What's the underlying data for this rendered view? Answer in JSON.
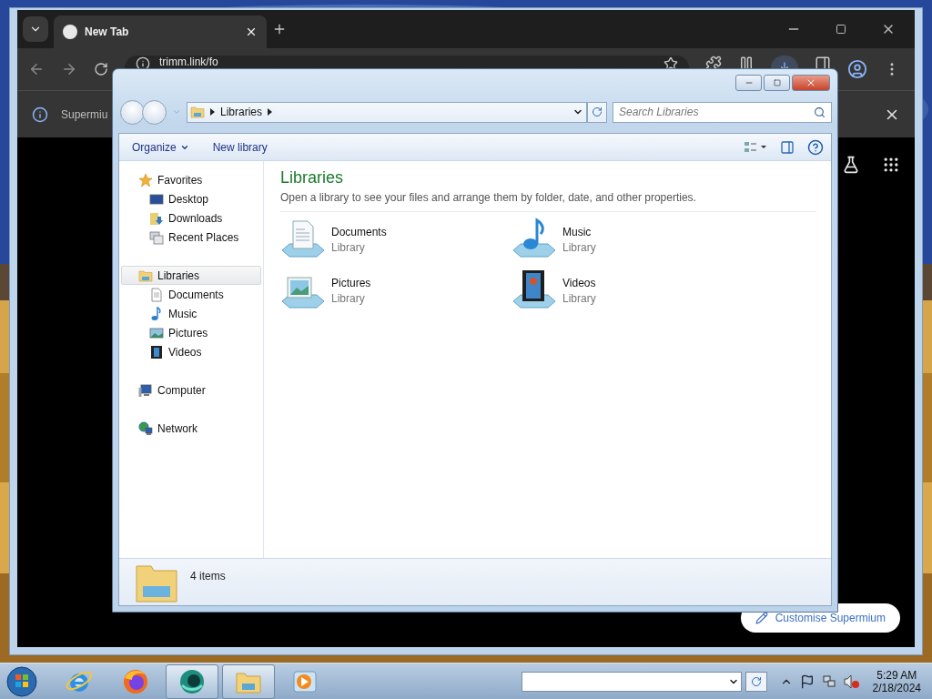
{
  "browser": {
    "tabs": [
      {
        "title": "New Tab",
        "selected": true
      }
    ],
    "address": "trimm.link/fo",
    "infobar": {
      "text": "Supermiu"
    },
    "customise_button": "Customise Supermium"
  },
  "explorer": {
    "breadcrumb": [
      "Libraries"
    ],
    "search": {
      "placeholder": "Search Libraries"
    },
    "commands": [
      {
        "label": "Organize",
        "kind": "menu"
      },
      {
        "label": "New library",
        "kind": "plain"
      }
    ],
    "nav": [
      {
        "label": "Favorites",
        "kind": "favorites",
        "selected": false,
        "children": [
          {
            "label": "Desktop",
            "kind": "desktop",
            "selected": false
          },
          {
            "label": "Downloads",
            "kind": "downloads",
            "selected": false
          },
          {
            "label": "Recent Places",
            "kind": "recent",
            "selected": false
          }
        ]
      },
      {
        "label": "Libraries",
        "kind": "libraries",
        "selected": true,
        "children": [
          {
            "label": "Documents",
            "kind": "documents",
            "selected": false
          },
          {
            "label": "Music",
            "kind": "music",
            "selected": false
          },
          {
            "label": "Pictures",
            "kind": "pictures",
            "selected": false
          },
          {
            "label": "Videos",
            "kind": "videos",
            "selected": false
          }
        ]
      },
      {
        "label": "Computer",
        "kind": "computer",
        "selected": false
      },
      {
        "label": "Network",
        "kind": "network",
        "selected": false
      }
    ],
    "heading": "Libraries",
    "description": "Open a library to see your files and arrange them by folder, date, and other properties.",
    "libraries": [
      {
        "name": "Documents",
        "type": "Library",
        "kind": "documents"
      },
      {
        "name": "Music",
        "type": "Library",
        "kind": "music"
      },
      {
        "name": "Pictures",
        "type": "Library",
        "kind": "pictures"
      },
      {
        "name": "Videos",
        "type": "Library",
        "kind": "videos"
      }
    ],
    "status": "4 items"
  },
  "taskbar": {
    "apps": [
      {
        "kind": "ie",
        "open": false
      },
      {
        "kind": "firefox",
        "open": false
      },
      {
        "kind": "app",
        "open": true
      },
      {
        "kind": "explorer",
        "open": true
      },
      {
        "kind": "media",
        "open": false
      }
    ],
    "clock": {
      "time": "5:29 AM",
      "date": "2/18/2024"
    }
  }
}
